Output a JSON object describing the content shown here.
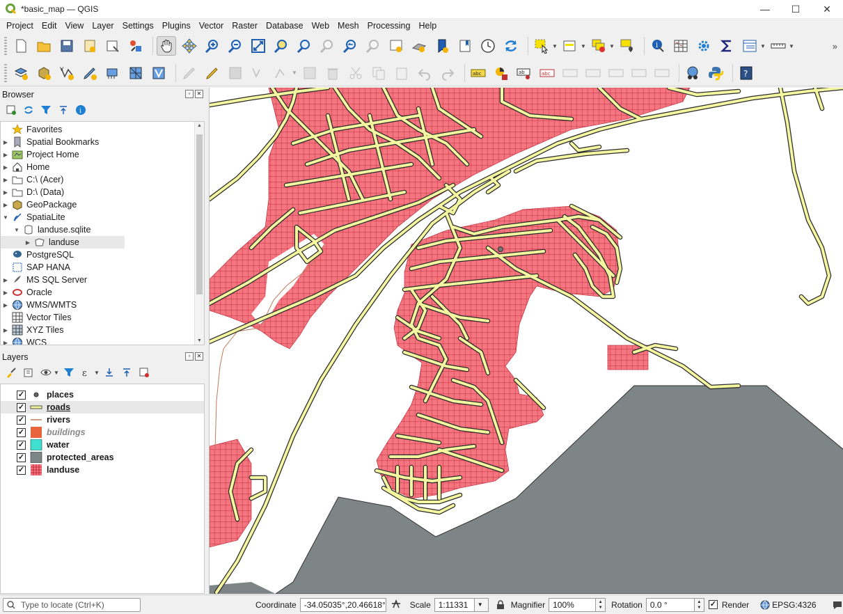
{
  "window": {
    "title": "*basic_map — QGIS",
    "minimize": "—",
    "maximize": "☐",
    "close": "✕"
  },
  "menu": [
    "Project",
    "Edit",
    "View",
    "Layer",
    "Settings",
    "Plugins",
    "Vector",
    "Raster",
    "Database",
    "Web",
    "Mesh",
    "Processing",
    "Help"
  ],
  "browser": {
    "title": "Browser",
    "items": [
      {
        "label": "Favorites",
        "icon": "star-icon",
        "arrow": ""
      },
      {
        "label": "Spatial Bookmarks",
        "icon": "bookmark-icon",
        "arrow": "▶"
      },
      {
        "label": "Project Home",
        "icon": "project-home-icon",
        "arrow": "▶"
      },
      {
        "label": "Home",
        "icon": "home-icon",
        "arrow": "▶"
      },
      {
        "label": "C:\\ (Acer)",
        "icon": "folder-icon",
        "arrow": "▶"
      },
      {
        "label": "D:\\ (Data)",
        "icon": "folder-icon",
        "arrow": "▶"
      },
      {
        "label": "GeoPackage",
        "icon": "geopackage-icon",
        "arrow": "▶"
      },
      {
        "label": "SpatiaLite",
        "icon": "spatialite-icon",
        "arrow": "▼"
      },
      {
        "label": "landuse.sqlite",
        "icon": "database-icon",
        "arrow": "▼"
      },
      {
        "label": "landuse",
        "icon": "polygon-layer-icon",
        "arrow": "▶"
      },
      {
        "label": "PostgreSQL",
        "icon": "postgresql-icon",
        "arrow": ""
      },
      {
        "label": "SAP HANA",
        "icon": "sap-hana-icon",
        "arrow": ""
      },
      {
        "label": "MS SQL Server",
        "icon": "mssql-icon",
        "arrow": "▶"
      },
      {
        "label": "Oracle",
        "icon": "oracle-icon",
        "arrow": "▶"
      },
      {
        "label": "WMS/WMTS",
        "icon": "globe-icon",
        "arrow": "▶"
      },
      {
        "label": "Vector Tiles",
        "icon": "vector-tiles-icon",
        "arrow": ""
      },
      {
        "label": "XYZ Tiles",
        "icon": "xyz-tiles-icon",
        "arrow": "▶"
      },
      {
        "label": "WCS",
        "icon": "globe-icon",
        "arrow": "▶"
      }
    ]
  },
  "layers": {
    "title": "Layers",
    "items": [
      {
        "label": "places",
        "checked": "✓",
        "style": "normal"
      },
      {
        "label": "roads",
        "checked": "✓",
        "style": "underline"
      },
      {
        "label": "rivers",
        "checked": "✓",
        "style": "normal"
      },
      {
        "label": "buildings",
        "checked": "✓",
        "style": "italic"
      },
      {
        "label": "water",
        "checked": "✓",
        "style": "normal"
      },
      {
        "label": "protected_areas",
        "checked": "✓",
        "style": "normal"
      },
      {
        "label": "landuse",
        "checked": "✓",
        "style": "normal"
      }
    ]
  },
  "colors": {
    "landuse_fill": "#f4747f",
    "landuse_grid": "#b3202e",
    "road_fill": "#f4f7a0",
    "road_casing": "#2a2a2a",
    "protected": "#7d8587",
    "water": "#40e0d0",
    "buildings": "#e8643c",
    "river": "#c07a5a"
  },
  "status": {
    "locate_placeholder": "Type to locate (Ctrl+K)",
    "coordinate_label": "Coordinate",
    "coordinate_value": "-34.05035°,20.46618°",
    "scale_label": "Scale",
    "scale_value": "1:11331",
    "magnifier_label": "Magnifier",
    "magnifier_value": "100%",
    "rotation_label": "Rotation",
    "rotation_value": "0.0 °",
    "render_label": "Render",
    "render_checked": "✓",
    "crs": "EPSG:4326"
  }
}
